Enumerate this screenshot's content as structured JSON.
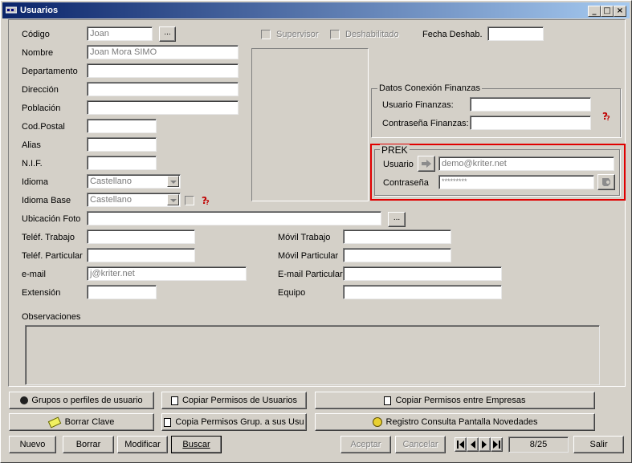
{
  "window": {
    "title": "Usuarios",
    "controls": [
      "_",
      "□",
      "×"
    ]
  },
  "form": {
    "codigo": {
      "label": "Código",
      "value": "Joan"
    },
    "nombre": {
      "label": "Nombre",
      "value": "Joan Mora SIMO"
    },
    "departamento": {
      "label": "Departamento",
      "value": ""
    },
    "direccion": {
      "label": "Dirección",
      "value": ""
    },
    "poblacion": {
      "label": "Población",
      "value": ""
    },
    "cod_postal": {
      "label": "Cod.Postal",
      "value": ""
    },
    "alias": {
      "label": "Alias",
      "value": ""
    },
    "nif": {
      "label": "N.I.F.",
      "value": ""
    },
    "idioma": {
      "label": "Idioma",
      "value": "Castellano"
    },
    "idioma_base": {
      "label": "Idioma Base",
      "value": "Castellano"
    },
    "ubicacion_foto": {
      "label": "Ubicación Foto",
      "value": ""
    },
    "telf_trabajo": {
      "label": "Teléf. Trabajo",
      "value": ""
    },
    "telf_particular": {
      "label": "Teléf. Particular",
      "value": ""
    },
    "email": {
      "label": "e-mail",
      "value": "j@kriter.net"
    },
    "extension": {
      "label": "Extensión",
      "value": ""
    },
    "movil_trabajo": {
      "label": "Móvil Trabajo",
      "value": ""
    },
    "movil_particular": {
      "label": "Móvil Particular",
      "value": ""
    },
    "email_particular": {
      "label": "E-mail Particular",
      "value": ""
    },
    "equipo": {
      "label": "Equipo",
      "value": ""
    },
    "supervisor": {
      "label": "Supervisor",
      "checked": false
    },
    "deshabilitado": {
      "label": "Deshabilitado",
      "checked": false
    },
    "fecha_deshab": {
      "label": "Fecha Deshab.",
      "value": ""
    },
    "observaciones": {
      "label": "Observaciones",
      "value": ""
    },
    "browse_label": "..."
  },
  "finanzas": {
    "title": "Datos Conexión Finanzas",
    "usuario_label": "Usuario Finanzas:",
    "usuario_value": "",
    "contrasena_label": "Contraseña Finanzas:",
    "contrasena_value": ""
  },
  "prek": {
    "title": "PREK",
    "usuario_label": "Usuario",
    "usuario_value": "demo@kriter.net",
    "contrasena_label": "Contraseña",
    "contrasena_value": "*********",
    "highlight_color": "#e00000"
  },
  "actions": {
    "grupos": "Grupos o perfiles de usuario",
    "copiar_permisos_usuarios": "Copiar Permisos de Usuarios",
    "copiar_permisos_empresas": "Copiar Permisos entre Empresas",
    "borrar_clave": "Borrar Clave",
    "copia_permisos_grup": "Copia Permisos Grup. a sus Usu",
    "registro_consulta": "Registro Consulta Pantalla Novedades"
  },
  "toolbar": {
    "nuevo": "Nuevo",
    "borrar": "Borrar",
    "modificar": "Modificar",
    "buscar": "Buscar",
    "aceptar": "Aceptar",
    "cancelar": "Cancelar",
    "record": "8/25",
    "salir": "Salir"
  }
}
